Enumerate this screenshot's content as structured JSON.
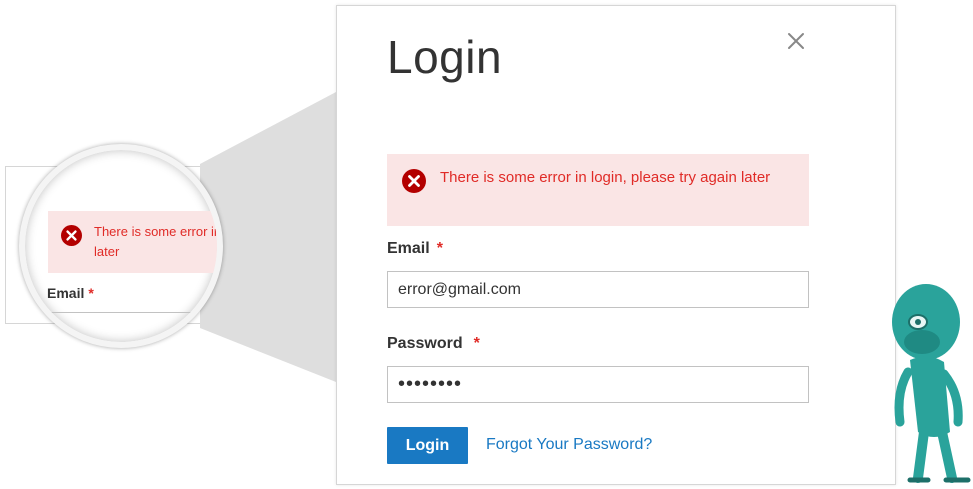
{
  "magnifier": {
    "error_message": "There is some error in login, please try again",
    "error_message_line2": "later",
    "email_label": "Email",
    "required_mark": "*"
  },
  "modal": {
    "title": "Login",
    "close_icon": "close-icon",
    "error": {
      "icon": "error-circle-icon",
      "message": "There is some error in login, please try again later"
    },
    "email": {
      "label": "Email",
      "required_mark": "*",
      "value": "error@gmail.com"
    },
    "password": {
      "label": "Password",
      "required_mark": "*",
      "value": "secretpw"
    },
    "login_button": "Login",
    "forgot_link": "Forgot Your Password?"
  },
  "colors": {
    "error_text": "#e02b27",
    "error_background": "#fae5e5",
    "primary_button": "#1979c3",
    "mascot": "#2aa39b"
  }
}
